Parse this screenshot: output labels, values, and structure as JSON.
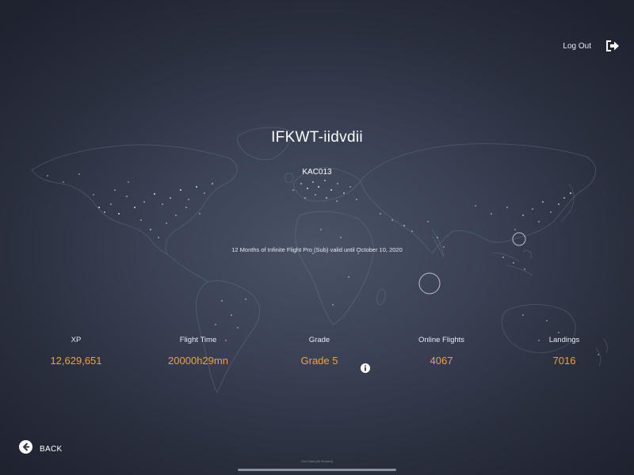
{
  "header": {
    "logout_label": "Log Out",
    "logout_icon": "logout-arrow-icon"
  },
  "profile": {
    "username": "IFKWT-iidvdii",
    "callsign": "KAC013",
    "subscription": "12 Months of Infinite Flight Pro (Sub) valid until October 10, 2020"
  },
  "stats": [
    {
      "label": "XP",
      "value": "12,629,651"
    },
    {
      "label": "Flight Time",
      "value": "20000h29mn"
    },
    {
      "label": "Grade",
      "value": "Grade 5"
    },
    {
      "label": "Online Flights",
      "value": "4067"
    },
    {
      "label": "Landings",
      "value": "7016"
    }
  ],
  "info_icon": "info-circle-icon",
  "footer": {
    "back_label": "BACK",
    "back_icon": "arrow-left-circle-icon",
    "note": "Live Data (All Servers)"
  },
  "colors": {
    "accent": "#f0a040",
    "text": "#ffffff",
    "background": "#3a4154"
  }
}
